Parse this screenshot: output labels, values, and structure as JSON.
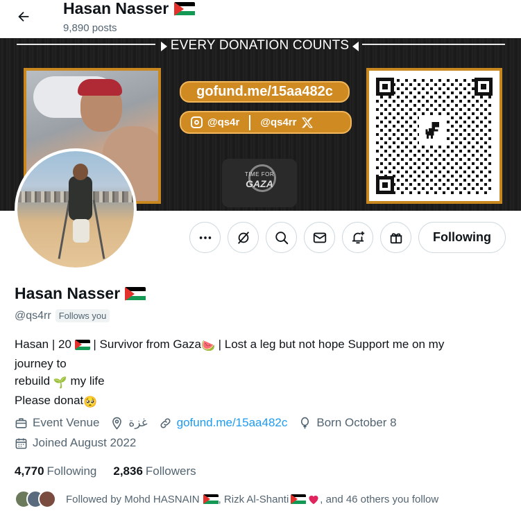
{
  "header": {
    "back_icon": "arrow-left-icon",
    "title": "Hasan Nasser",
    "posts": "9,890 posts"
  },
  "banner": {
    "headline": "EVERY DONATION COUNTS",
    "link": "gofund.me/15aa482c",
    "instagram": "@qs4r",
    "x_handle": "@qs4rr",
    "logo_line1": "TIME FOR",
    "logo_line2": "GAZA",
    "qr_icon": "dinosaur-icon",
    "accent_color": "#d08a22"
  },
  "actions": {
    "more_icon": "more-icon",
    "grok_icon": "grok-icon",
    "search_icon": "search-icon",
    "message_icon": "mail-icon",
    "notify_icon": "bell-plus-icon",
    "gift_icon": "gift-icon",
    "follow_label": "Following"
  },
  "profile": {
    "name": "Hasan Nasser",
    "handle": "@qs4rr",
    "follows_you": "Follows you",
    "bio": {
      "line1_a": "Hasan | 20",
      "line1_b": "| Survivor from Gaza",
      "line1_c": " | Lost a leg but not hope Support me on my",
      "line2": "journey to",
      "line3_a": "rebuild",
      "line3_b": "my life",
      "line4": "Please donat"
    },
    "meta": {
      "category": "Event Venue",
      "location": "غزة",
      "website": "gofund.me/15aa482c",
      "birthday": "Born October 8",
      "joined": "Joined August 2022"
    },
    "stats": {
      "following_count": "4,770",
      "following_label": "Following",
      "followers_count": "2,836",
      "followers_label": "Followers"
    },
    "followed_by": {
      "prefix": "Followed by Mohd HASNAIN",
      "sep": ", Rizk Al-Shanti",
      "suffix": ", and 46 others you follow"
    }
  }
}
